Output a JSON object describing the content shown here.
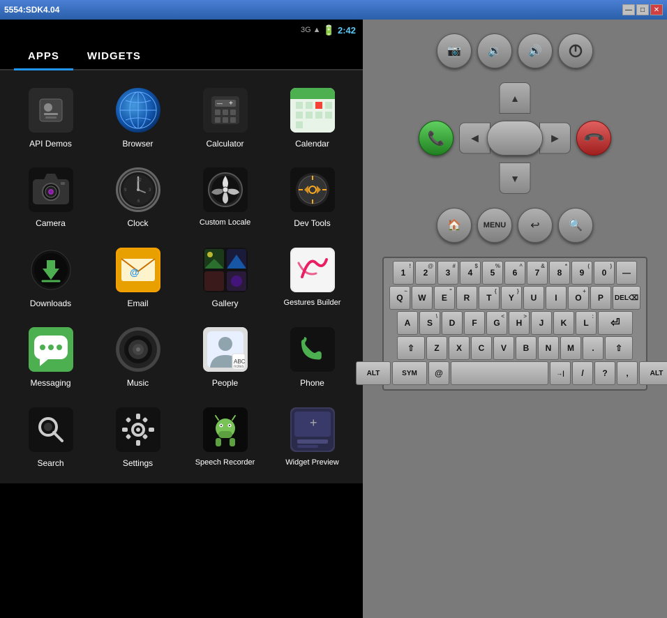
{
  "titleBar": {
    "title": "5554:SDK4.04",
    "minBtn": "—",
    "maxBtn": "□",
    "closeBtn": "✕"
  },
  "statusBar": {
    "signal": "3G",
    "time": "2:42"
  },
  "tabs": [
    {
      "id": "apps",
      "label": "APPS",
      "active": true
    },
    {
      "id": "widgets",
      "label": "WIDGETS",
      "active": false
    }
  ],
  "apps": [
    {
      "id": "api-demos",
      "label": "API Demos"
    },
    {
      "id": "browser",
      "label": "Browser"
    },
    {
      "id": "calculator",
      "label": "Calculator"
    },
    {
      "id": "calendar",
      "label": "Calendar"
    },
    {
      "id": "camera",
      "label": "Camera"
    },
    {
      "id": "clock",
      "label": "Clock"
    },
    {
      "id": "custom-locale",
      "label": "Custom Locale"
    },
    {
      "id": "dev-tools",
      "label": "Dev Tools"
    },
    {
      "id": "downloads",
      "label": "Downloads"
    },
    {
      "id": "email",
      "label": "Email"
    },
    {
      "id": "gallery",
      "label": "Gallery"
    },
    {
      "id": "gestures-builder",
      "label": "Gestures Builder"
    },
    {
      "id": "messaging",
      "label": "Messaging"
    },
    {
      "id": "music",
      "label": "Music"
    },
    {
      "id": "people",
      "label": "People"
    },
    {
      "id": "phone",
      "label": "Phone"
    },
    {
      "id": "search",
      "label": "Search"
    },
    {
      "id": "settings",
      "label": "Settings"
    },
    {
      "id": "speech-recorder",
      "label": "Speech Recorder"
    },
    {
      "id": "widget-preview",
      "label": "Widget Preview"
    }
  ],
  "keyboard": {
    "rows": [
      [
        {
          "main": "1",
          "sub": "!"
        },
        {
          "main": "2",
          "sub": "@"
        },
        {
          "main": "3",
          "sub": "#"
        },
        {
          "main": "4",
          "sub": "$"
        },
        {
          "main": "5",
          "sub": "%"
        },
        {
          "main": "6",
          "sub": "^"
        },
        {
          "main": "7",
          "sub": "&"
        },
        {
          "main": "8",
          "sub": "*"
        },
        {
          "main": "9",
          "sub": "("
        },
        {
          "main": "0",
          "sub": ")"
        },
        {
          "main": "—",
          "sub": ""
        }
      ],
      [
        {
          "main": "Q",
          "sub": "~"
        },
        {
          "main": "W",
          "sub": ""
        },
        {
          "main": "E",
          "sub": "\""
        },
        {
          "main": "R",
          "sub": ""
        },
        {
          "main": "T",
          "sub": "{"
        },
        {
          "main": "Y",
          "sub": "}"
        },
        {
          "main": "U",
          "sub": ""
        },
        {
          "main": "I",
          "sub": ""
        },
        {
          "main": "O",
          "sub": "+"
        },
        {
          "main": "P",
          "sub": ""
        },
        {
          "main": "⌫",
          "sub": ""
        }
      ],
      [
        {
          "main": "A",
          "sub": ""
        },
        {
          "main": "S",
          "sub": "\\"
        },
        {
          "main": "D",
          "sub": ""
        },
        {
          "main": "F",
          "sub": ""
        },
        {
          "main": "G",
          "sub": "<"
        },
        {
          "main": "H",
          "sub": ">"
        },
        {
          "main": "J",
          "sub": ""
        },
        {
          "main": "K",
          "sub": ""
        },
        {
          "main": "L",
          "sub": ":"
        },
        {
          "main": "⏎",
          "sub": ""
        }
      ],
      [
        {
          "main": "⇧",
          "sub": ""
        },
        {
          "main": "Z",
          "sub": ""
        },
        {
          "main": "X",
          "sub": ""
        },
        {
          "main": "C",
          "sub": ""
        },
        {
          "main": "V",
          "sub": ""
        },
        {
          "main": "B",
          "sub": ""
        },
        {
          "main": "N",
          "sub": ""
        },
        {
          "main": "M",
          "sub": ""
        },
        {
          "main": ".",
          "sub": ""
        },
        {
          "main": "⇧",
          "sub": ""
        }
      ],
      [
        {
          "main": "ALT",
          "sub": ""
        },
        {
          "main": "SYM",
          "sub": ""
        },
        {
          "main": "@",
          "sub": ""
        },
        {
          "main": "  ",
          "sub": ""
        },
        {
          "main": "→|",
          "sub": ""
        },
        {
          "main": "/",
          "sub": ""
        },
        {
          "main": "?",
          "sub": ""
        },
        {
          "main": ",",
          "sub": ""
        },
        {
          "main": "ALT",
          "sub": ""
        }
      ]
    ]
  }
}
